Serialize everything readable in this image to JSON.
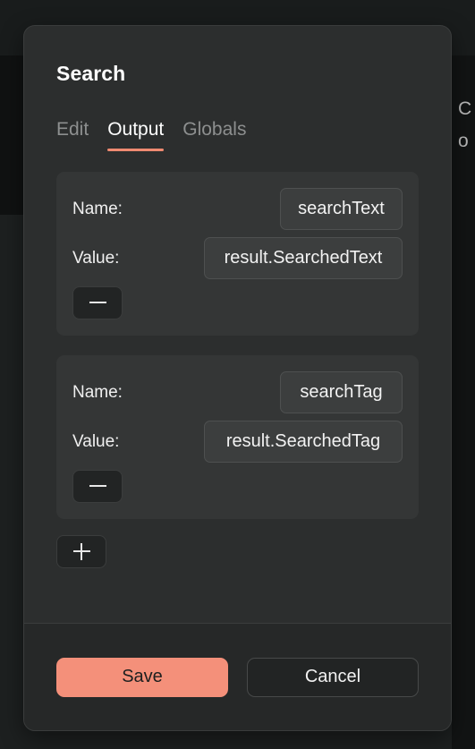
{
  "backdrop": {
    "partial_text_right_edge": "C\no"
  },
  "modal": {
    "title": "Search",
    "tabs": [
      {
        "label": "Edit",
        "active": false
      },
      {
        "label": "Output",
        "active": true
      },
      {
        "label": "Globals",
        "active": false
      }
    ],
    "entries": [
      {
        "name_label": "Name:",
        "name_value": "searchText",
        "value_label": "Value:",
        "value_value": "result.SearchedText",
        "remove_icon": "minus-icon"
      },
      {
        "name_label": "Name:",
        "name_value": "searchTag",
        "value_label": "Value:",
        "value_value": "result.SearchedTag",
        "remove_icon": "minus-icon"
      }
    ],
    "add_entry_icon": "plus-icon",
    "footer": {
      "save_label": "Save",
      "cancel_label": "Cancel"
    }
  },
  "colors": {
    "accent": "#ef8a71",
    "save_button": "#f4907a",
    "modal_background": "#2c2e2e",
    "card_background": "#343636",
    "input_background": "#3c3e3e",
    "text_primary": "#ffffff",
    "text_muted": "#8d8f8f"
  }
}
